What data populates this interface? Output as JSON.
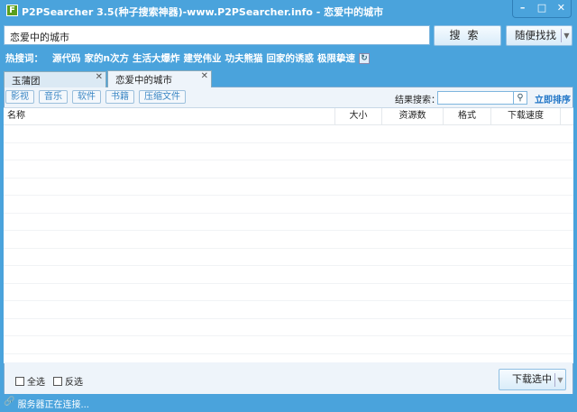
{
  "window": {
    "title": "P2PSearcher 3.5(种子搜索神器)-www.P2PSearcher.info - 恋爱中的城市",
    "icon": "F",
    "minimize": "–",
    "maximize": "□",
    "close": "✕"
  },
  "search": {
    "value": "恋爱中的城市",
    "button": "搜索",
    "random_button": "随便找找"
  },
  "hot": {
    "label": "热搜词：",
    "keywords": [
      "源代码",
      "家的n次方",
      "生活大爆炸",
      "建党伟业",
      "功夫熊猫",
      "回家的诱惑",
      "极限挚速"
    ]
  },
  "tabs": [
    {
      "label": "玉蒲团"
    },
    {
      "label": "恋爱中的城市",
      "active": true
    }
  ],
  "filters": [
    "影视",
    "音乐",
    "软件",
    "书籍",
    "压缩文件"
  ],
  "result_search": {
    "label": "结果搜索：",
    "value": "",
    "sort_link": "立即排序"
  },
  "table": {
    "columns": [
      "名称",
      "大小",
      "资源数",
      "格式",
      "下载速度"
    ],
    "rows": []
  },
  "bottom": {
    "select_all": "全选",
    "invert": "反选",
    "download_button": "下载选中"
  },
  "status": {
    "text": "服务器正在连接..."
  }
}
